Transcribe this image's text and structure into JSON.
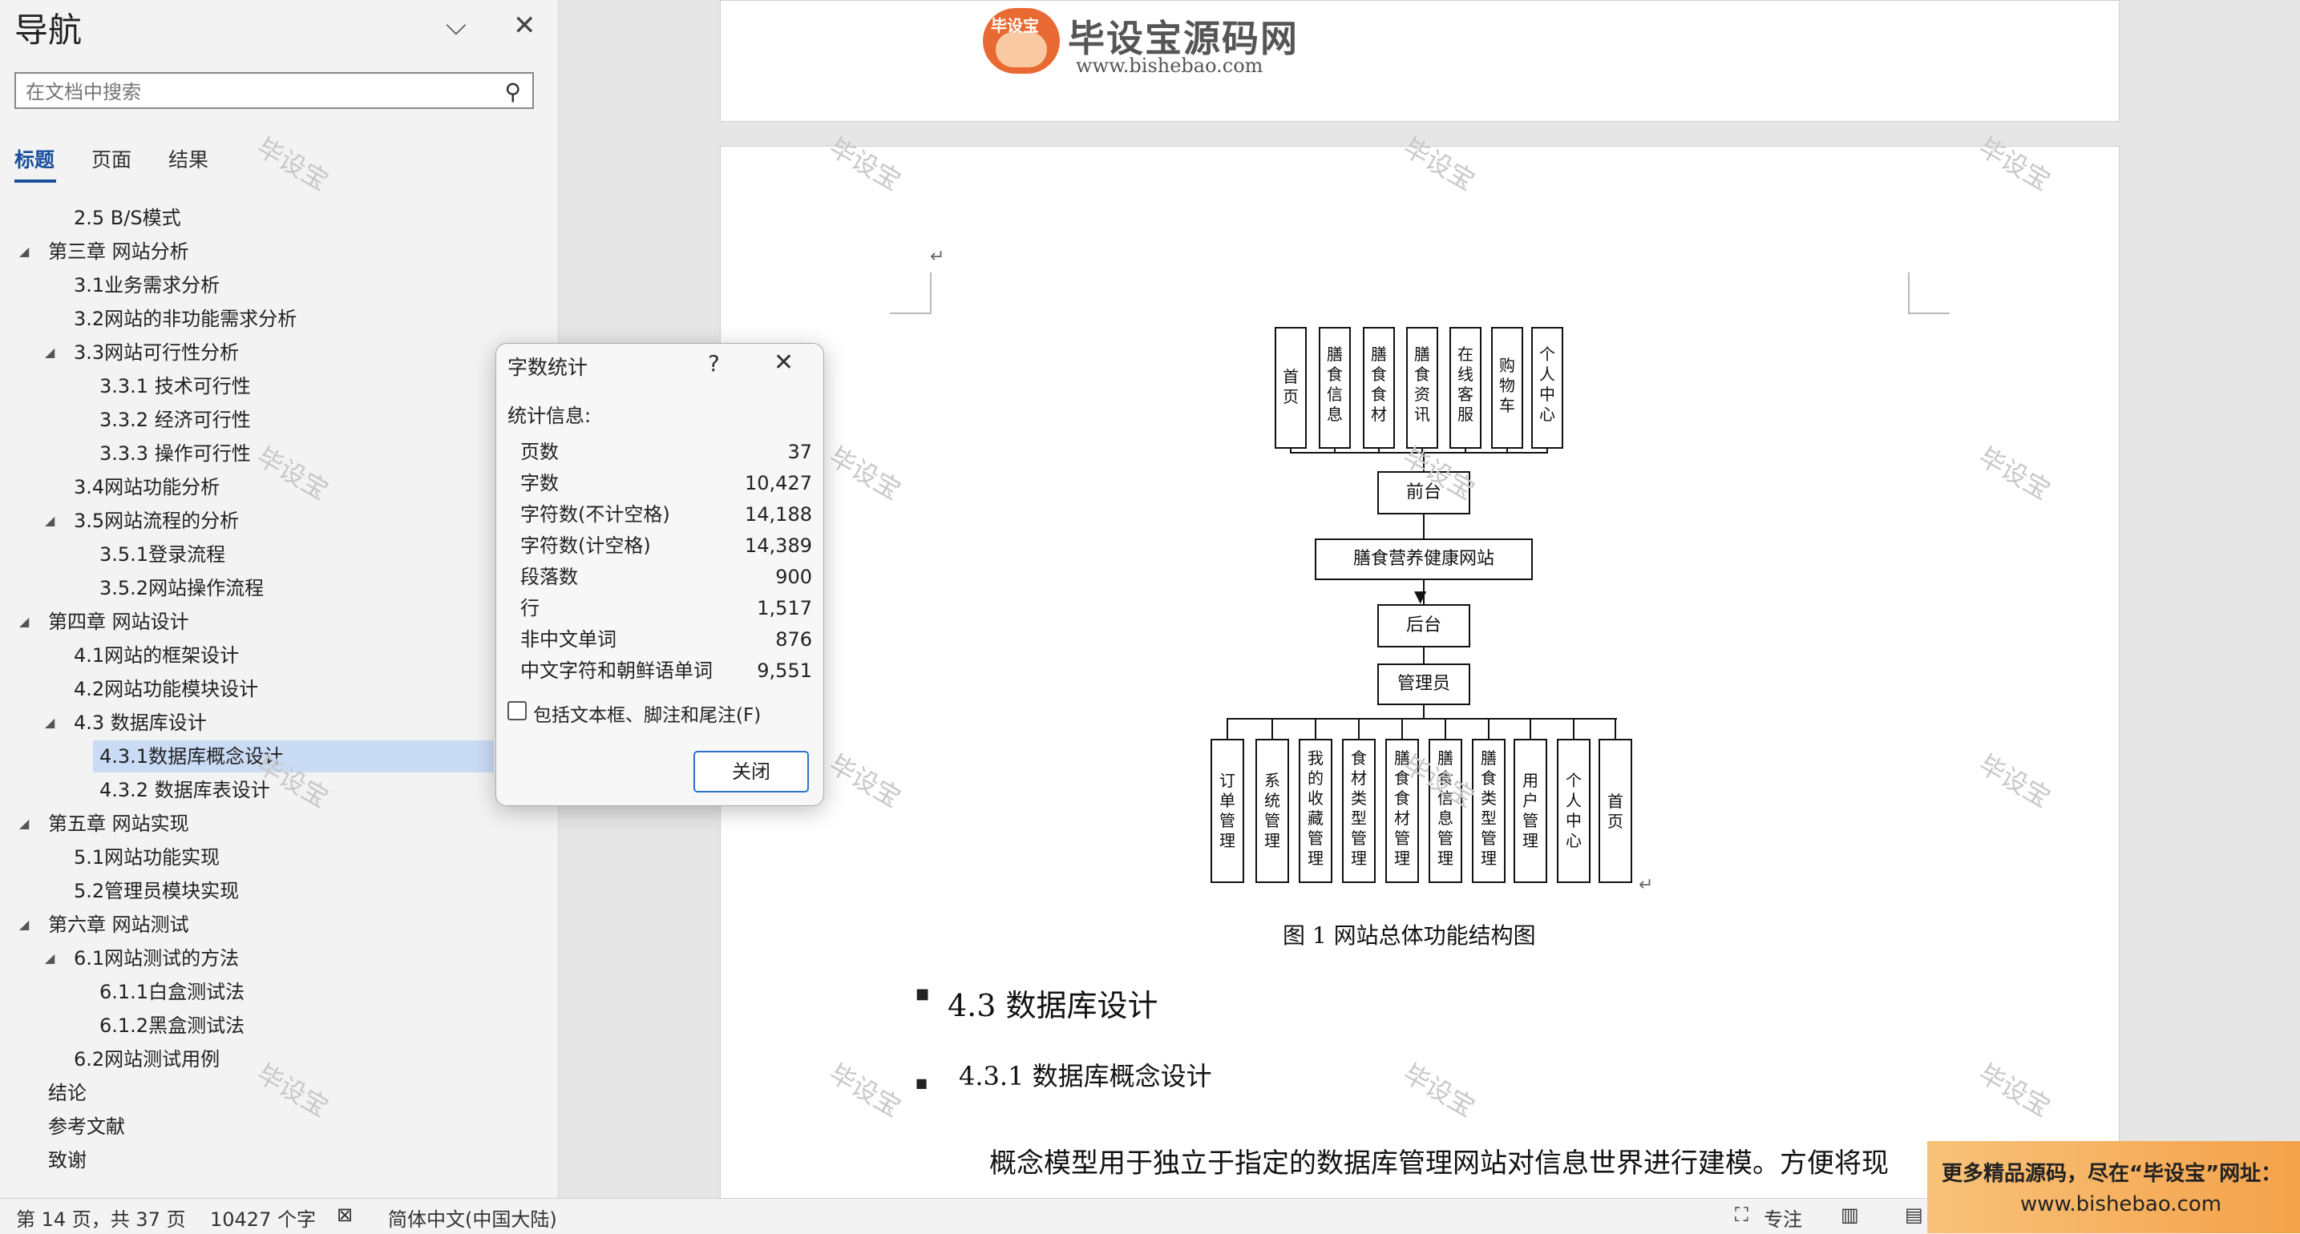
{
  "nav": {
    "title": "导航",
    "search_placeholder": "在文档中搜索",
    "tabs": [
      "标题",
      "页面",
      "结果"
    ],
    "items": [
      {
        "label": "2.5 B/S模式",
        "level": 2,
        "expanded": null
      },
      {
        "label": "第三章 网站分析",
        "level": 1,
        "expanded": true
      },
      {
        "label": "3.1业务需求分析",
        "level": 2,
        "expanded": null
      },
      {
        "label": "3.2网站的非功能需求分析",
        "level": 2,
        "expanded": null
      },
      {
        "label": "3.3网站可行性分析",
        "level": 2,
        "expanded": true
      },
      {
        "label": "3.3.1 技术可行性",
        "level": 3,
        "expanded": null
      },
      {
        "label": "3.3.2 经济可行性",
        "level": 3,
        "expanded": null
      },
      {
        "label": "3.3.3 操作可行性",
        "level": 3,
        "expanded": null
      },
      {
        "label": "3.4网站功能分析",
        "level": 2,
        "expanded": null
      },
      {
        "label": "3.5网站流程的分析",
        "level": 2,
        "expanded": true
      },
      {
        "label": "3.5.1登录流程",
        "level": 3,
        "expanded": null
      },
      {
        "label": "3.5.2网站操作流程",
        "level": 3,
        "expanded": null
      },
      {
        "label": "第四章 网站设计",
        "level": 1,
        "expanded": true
      },
      {
        "label": "4.1网站的框架设计",
        "level": 2,
        "expanded": null
      },
      {
        "label": "4.2网站功能模块设计",
        "level": 2,
        "expanded": null
      },
      {
        "label": "4.3 数据库设计",
        "level": 2,
        "expanded": true
      },
      {
        "label": "4.3.1数据库概念设计",
        "level": 3,
        "expanded": null,
        "selected": true
      },
      {
        "label": "4.3.2 数据库表设计",
        "level": 3,
        "expanded": null
      },
      {
        "label": "第五章 网站实现",
        "level": 1,
        "expanded": true
      },
      {
        "label": "5.1网站功能实现",
        "level": 2,
        "expanded": null
      },
      {
        "label": "5.2管理员模块实现",
        "level": 2,
        "expanded": null
      },
      {
        "label": "第六章 网站测试",
        "level": 1,
        "expanded": true
      },
      {
        "label": "6.1网站测试的方法",
        "level": 2,
        "expanded": true
      },
      {
        "label": "6.1.1白盒测试法",
        "level": 3,
        "expanded": null
      },
      {
        "label": "6.1.2黑盒测试法",
        "level": 3,
        "expanded": null
      },
      {
        "label": "6.2网站测试用例",
        "level": 2,
        "expanded": null
      },
      {
        "label": "结论",
        "level": 1,
        "expanded": null
      },
      {
        "label": "参考文献",
        "level": 1,
        "expanded": null
      },
      {
        "label": "致谢",
        "level": 1,
        "expanded": null
      }
    ]
  },
  "watermark": "毕设宝",
  "logo": {
    "badge": "毕设宝",
    "title": "毕设宝源码网",
    "url": "www.bishebao.com"
  },
  "diagram": {
    "top_boxes": [
      "首页",
      "膳食信息",
      "膳食食材",
      "膳食资讯",
      "在线客服",
      "购物车",
      "个人中心"
    ],
    "frontend": "前台",
    "site": "膳食营养健康网站",
    "backend": "后台",
    "admin": "管理员",
    "bottom_boxes": [
      "订单管理",
      "系统管理",
      "我的收藏管理",
      "食材类型管理",
      "膳食食材管理",
      "膳食信息管理",
      "膳食类型管理",
      "用户管理",
      "个人中心",
      "首页"
    ],
    "caption": "图 1  网站总体功能结构图"
  },
  "doc": {
    "heading2": "4.3  数据库设计",
    "heading3": "4.3.1 数据库概念设计",
    "paragraph": "概念模型用于独立于指定的数据库管理网站对信息世界进行建模。方便将现"
  },
  "dialog": {
    "title": "字数统计",
    "help": "?",
    "subtitle": "统计信息:",
    "rows": [
      {
        "label": "页数",
        "value": "37"
      },
      {
        "label": "字数",
        "value": "10,427"
      },
      {
        "label": "字符数(不计空格)",
        "value": "14,188"
      },
      {
        "label": "字符数(计空格)",
        "value": "14,389"
      },
      {
        "label": "段落数",
        "value": "900"
      },
      {
        "label": "行",
        "value": "1,517"
      },
      {
        "label": "非中文单词",
        "value": "876"
      },
      {
        "label": "中文字符和朝鲜语单词",
        "value": "9,551"
      }
    ],
    "checkbox_label": "包括文本框、脚注和尾注(F)",
    "close_button": "关闭"
  },
  "status": {
    "page": "第 14 页，共 37 页",
    "words": "10427 个字",
    "language": "简体中文(中国大陆)",
    "focus": "专注"
  },
  "ad": {
    "line1": "更多精品源码，尽在“毕设宝”网址：",
    "line2": "www.bishebao.com"
  }
}
